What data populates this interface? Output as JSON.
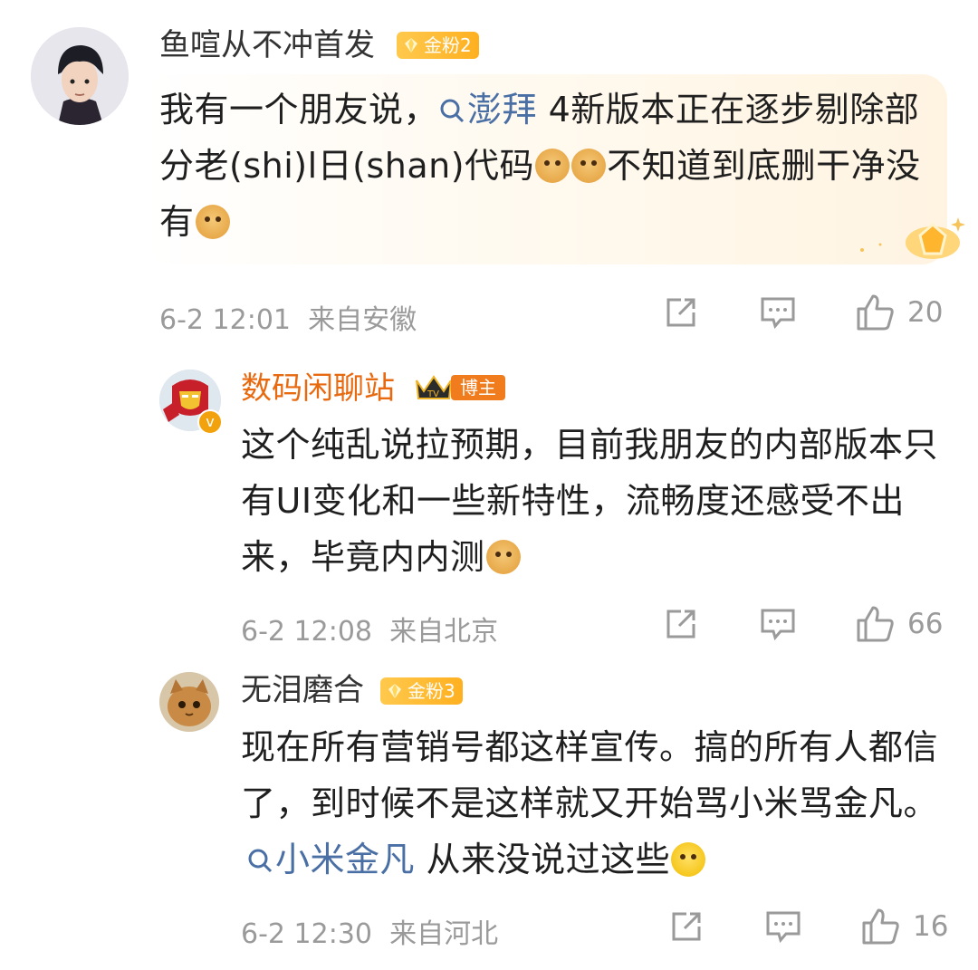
{
  "comments": [
    {
      "username": "鱼喧从不冲首发",
      "badge": "金粉2",
      "text_before": "我有一个朋友说，",
      "topic": "澎拜",
      "text_after_topic": " 4新版本正在逐步剔除部分老(shi)l日(shan)代码",
      "text_after_emoji": "不知道到底删干净没有",
      "time": "6-2 12:01",
      "location": "来自安徽",
      "likes": "20"
    },
    {
      "username": "数码闲聊站",
      "badge": "博主",
      "text": "这个纯乱说拉预期，目前我朋友的内部版本只有UI变化和一些新特性，流畅度还感受不出来，毕竟内内测",
      "time": "6-2 12:08",
      "location": "来自北京",
      "likes": "66"
    },
    {
      "username": "无泪磨合",
      "badge": "金粉3",
      "text_before": "现在所有营销号都这样宣传。搞的所有人都信了，到时候不是这样就又开始骂小米骂金凡。",
      "topic": "小米金凡",
      "text_after_topic": " 从来没说过这些",
      "time": "6-2 12:30",
      "location": "来自河北",
      "likes": "16"
    }
  ],
  "icons": {
    "share": "share-icon",
    "comment": "comment-icon",
    "like": "thumbs-up-icon",
    "topic": "search-icon",
    "badge": "gem-icon",
    "crown": "crown-icon",
    "emoji": "doge-emoji-icon",
    "laugh": "laugh-cry-emoji-icon"
  },
  "colors": {
    "topic": "#4a6fa5",
    "vip_name": "#e86a10",
    "badge": "#ffb020",
    "meta": "#9a9a9a"
  }
}
